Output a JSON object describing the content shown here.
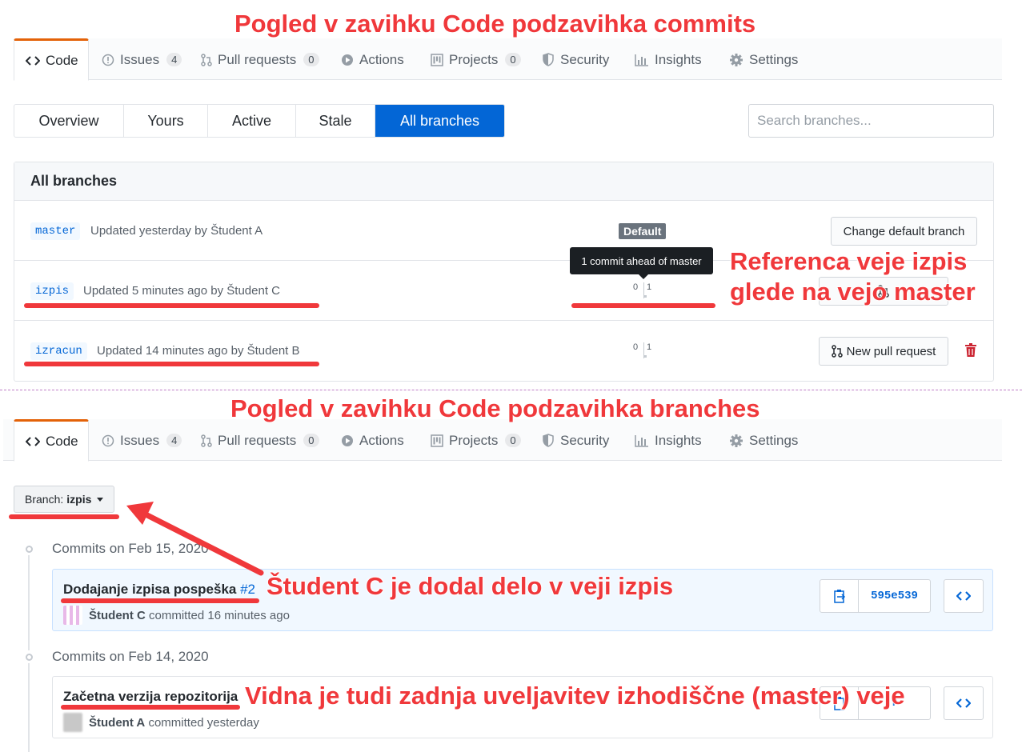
{
  "annotations": {
    "top_title": "Pogled v zavihku Code podzavihka commits",
    "ref_line1": "Referenca veje izpis",
    "ref_line2": "glede na vejo master",
    "bottom_title": "Pogled v zavihku Code podzavihka branches",
    "student_note": "Študent C je dodal delo v veji izpis",
    "master_note": "Vidna je tudi zadnja uveljavitev izhodiščne (master) veje"
  },
  "repo_tabs": [
    {
      "label": "Code",
      "icon": "code-icon"
    },
    {
      "label": "Issues",
      "icon": "issue-icon",
      "count": "4"
    },
    {
      "label": "Pull requests",
      "icon": "pull-request-icon",
      "count": "0"
    },
    {
      "label": "Actions",
      "icon": "play-icon"
    },
    {
      "label": "Projects",
      "icon": "project-icon",
      "count": "0"
    },
    {
      "label": "Security",
      "icon": "shield-icon"
    },
    {
      "label": "Insights",
      "icon": "graph-icon"
    },
    {
      "label": "Settings",
      "icon": "gear-icon"
    }
  ],
  "branch_filters": [
    "Overview",
    "Yours",
    "Active",
    "Stale",
    "All branches"
  ],
  "branch_filter_selected": "All branches",
  "search": {
    "placeholder": "Search branches..."
  },
  "branches_box": {
    "header": "All branches",
    "rows": [
      {
        "name": "master",
        "updated": "Updated yesterday by Študent A",
        "badge": "Default",
        "action": "Change default branch"
      },
      {
        "name": "izpis",
        "updated": "Updated 5 minutes ago by Študent C",
        "behind": "0",
        "ahead": "1",
        "tooltip": "1 commit ahead of master"
      },
      {
        "name": "izracun",
        "updated": "Updated 14 minutes ago by Študent B",
        "behind": "0",
        "ahead": "1",
        "action": "New pull request"
      }
    ]
  },
  "branch_select": {
    "prefix": "Branch:",
    "value": "izpis"
  },
  "commit_groups": [
    {
      "date": "Commits on Feb 15, 2020",
      "commits": [
        {
          "title": "Dodajanje izpisa pospeška",
          "pr": "#2",
          "author": "Študent C",
          "when": "committed 16 minutes ago",
          "sha": "595e539"
        }
      ]
    },
    {
      "date": "Commits on Feb 14, 2020",
      "commits": [
        {
          "title": "Začetna verzija repozitorija",
          "author": "Študent A",
          "when": "committed yesterday",
          "sha": "f"
        }
      ]
    }
  ],
  "colors": {
    "accent": "#0366d6",
    "annotation": "#f0383b",
    "tab_border": "#e36209"
  }
}
